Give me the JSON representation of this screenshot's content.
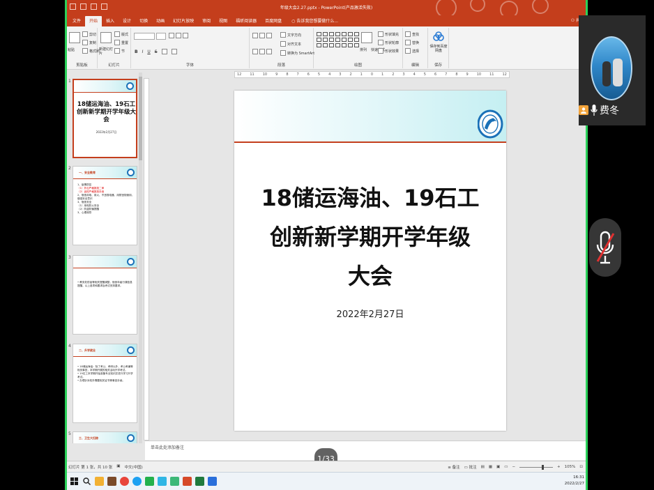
{
  "window": {
    "title": "年级大会2.27.pptx - PowerPoint(产品激活失败)"
  },
  "ribbon": {
    "tabs": [
      "文件",
      "开始",
      "插入",
      "设计",
      "切换",
      "动画",
      "幻灯片放映",
      "审阅",
      "视图",
      "福昕阅读器",
      "百度网盘"
    ],
    "active_tab": "开始",
    "tell_me": "告诉我您想要做什么...",
    "share": "共享",
    "groups": {
      "clipboard": {
        "label": "剪贴板",
        "paste": "粘贴",
        "cut": "剪切",
        "copy": "复制",
        "format_painter": "格式刷"
      },
      "slides": {
        "label": "幻灯片",
        "new_slide": "新建幻灯片",
        "layout": "版式",
        "reset": "重置",
        "section": "节"
      },
      "font": {
        "label": "字体",
        "bold": "B",
        "italic": "I",
        "underline": "U",
        "strike": "S"
      },
      "paragraph": {
        "label": "段落",
        "text_direction": "文字方向",
        "align_text": "对齐文本",
        "smartart": "转换为 SmartArt"
      },
      "drawing": {
        "label": "绘图",
        "arrange": "排列",
        "quick_styles": "快速样式",
        "fill": "形状填充",
        "outline": "形状轮廓",
        "effects": "形状效果"
      },
      "editing": {
        "label": "编辑",
        "find": "查找",
        "replace": "替换",
        "select": "选择"
      },
      "save": {
        "label": "保存",
        "save_to": "保存到百度网盘"
      }
    }
  },
  "ruler": {
    "ticks": [
      "12",
      "11",
      "10",
      "9",
      "8",
      "7",
      "6",
      "5",
      "4",
      "3",
      "2",
      "1",
      "0",
      "1",
      "2",
      "3",
      "4",
      "5",
      "6",
      "7",
      "8",
      "9",
      "10",
      "11",
      "12"
    ]
  },
  "thumbnails": [
    {
      "num": "1",
      "title": "18储运海油、19石工创新新学期开学年级大会",
      "date": "2022年2月27日"
    },
    {
      "num": "2",
      "heading": "一、安全教育",
      "lines": [
        "1、疫情防控",
        "（1）外出严格报批二审",
        "（2）返校严格报批手续",
        "2、宿舍用电、用火、不违规电器、用禁违规使用，增强安全意识",
        "3、宿舍安全",
        "（1）用电防火安全",
        "（2）防盗防骗提醒",
        "3、心理疏导"
      ]
    },
    {
      "num": "3",
      "lines": [
        "• 教务处防疫等相关提醒调整，宿舍年级行课信息提醒，以上各项和要求及考试安排要求。"
      ]
    },
    {
      "num": "4",
      "heading": "二、升学就业",
      "lines": [
        "• 18储运海油：除了考公、考研以外，考公考编等相关事宜，本学期开展的相关活动升学考试。",
        "• 19石工本学期开始准备专业知识并进行学习升学考试。",
        "• 办理针对校外需要相关证书等事宜手续。"
      ]
    },
    {
      "num": "5",
      "heading": "三、卫生大扫除"
    }
  ],
  "slide": {
    "title_lines": [
      "18储运海油、19石工",
      "创新新学期开学年级",
      "大会"
    ],
    "date": "2022年2月27日"
  },
  "notes": {
    "placeholder": "单击此处添加备注"
  },
  "pager": {
    "text": "1/33"
  },
  "status": {
    "slide_info": "幻灯片 第 1 张，共 10 张",
    "language": "中文(中国)",
    "notes_btn": "备注",
    "comments_btn": "批注",
    "zoom": "105%"
  },
  "taskbar": {
    "time": "16:31",
    "date": "2022/2/27"
  },
  "participant": {
    "name": "费冬"
  },
  "colors": {
    "accent": "#c43e1c",
    "highlight_green": "#2bd15a",
    "logo_blue": "#1b71b8"
  }
}
